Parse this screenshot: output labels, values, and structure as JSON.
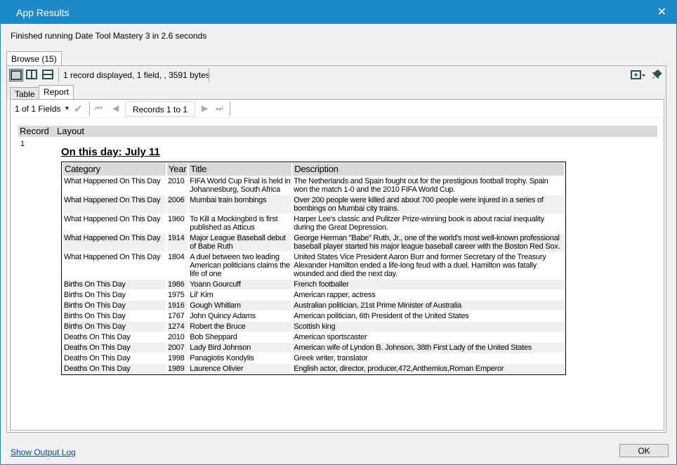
{
  "window": {
    "title": "App Results",
    "close_icon": "close-icon"
  },
  "status": "Finished running Date Tool Mastery 3 in 2.6 seconds",
  "browse_tab": "Browse (15)",
  "toolbar": {
    "info": "1 record displayed, 1 field, , 3591 bytes"
  },
  "subtabs": [
    "Table",
    "Report"
  ],
  "nav": {
    "fields": "1 of 1 Fields",
    "records": "Records 1 to 1"
  },
  "report": {
    "col_record": "Record",
    "col_layout": "Layout",
    "record_num": "1",
    "heading": "On this day: July 11",
    "headers": [
      "Category",
      "Year",
      "Title",
      "Description"
    ],
    "rows": [
      [
        "What Happened On This Day",
        "2010",
        "FIFA World Cup Final is held in Johannesburg, South Africa",
        "The Netherlands and Spain fought out for the prestigious football trophy. Spain won the match 1-0 and the 2010 FIFA World Cup."
      ],
      [
        "What Happened On This Day",
        "2006",
        "Mumbai train bombings",
        "Over 200 people were killed and about 700 people were injured in a series of bombings on Mumbai city trains."
      ],
      [
        "What Happened On This Day",
        "1960",
        "To Kill a Mockingbird is first published as Atticus",
        "Harper Lee's classic and Pulitzer Prize-winning book is about racial inequality during the Great Depression."
      ],
      [
        "What Happened On This Day",
        "1914",
        "Major League Baseball debut of Babe Ruth",
        "George Herman \"Babe\" Ruth, Jr., one of the world's most well-known professional baseball player started his major league baseball career with the Boston Red Sox."
      ],
      [
        "What Happened On This Day",
        "1804",
        "A duel between two leading American politicians claims the life of one",
        "United States Vice President Aaron Burr and former Secretary of the Treasury Alexander Hamilton ended a life-long feud with a duel. Hamilton was fatally wounded and died the next day."
      ],
      [
        "Births On This Day",
        "1986",
        "Yoann Gourcuff",
        "French footballer"
      ],
      [
        "Births On This Day",
        "1975",
        "Lil' Kim",
        "American rapper, actress"
      ],
      [
        "Births On This Day",
        "1916",
        "Gough Whitlam",
        "Australian politician, 21st Prime Minister of Australia"
      ],
      [
        "Births On This Day",
        "1767",
        "John Quincy Adams",
        "American politician, 6th President of the United States"
      ],
      [
        "Births On This Day",
        "1274",
        "Robert the Bruce",
        "Scottish king"
      ],
      [
        "Deaths On This Day",
        "2010",
        "Bob Sheppard",
        "American sportscaster"
      ],
      [
        "Deaths On This Day",
        "2007",
        "Lady Bird Johnson",
        "American wife of Lyndon B. Johnson, 38th First Lady of the United States"
      ],
      [
        "Deaths On This Day",
        "1998",
        "Panagiotis Kondylis",
        "Greek writer, translator"
      ],
      [
        "Deaths On This Day",
        "1989",
        "Laurence Olivier",
        "English actor, director, producer,472,Anthemius,Roman Emperor"
      ]
    ]
  },
  "footer": {
    "log_link": "Show Output Log",
    "ok": "OK"
  },
  "colors": {
    "titlebar": "#1c8ac9",
    "header_bg": "#d9d9d9",
    "alt_row": "#efefef"
  }
}
